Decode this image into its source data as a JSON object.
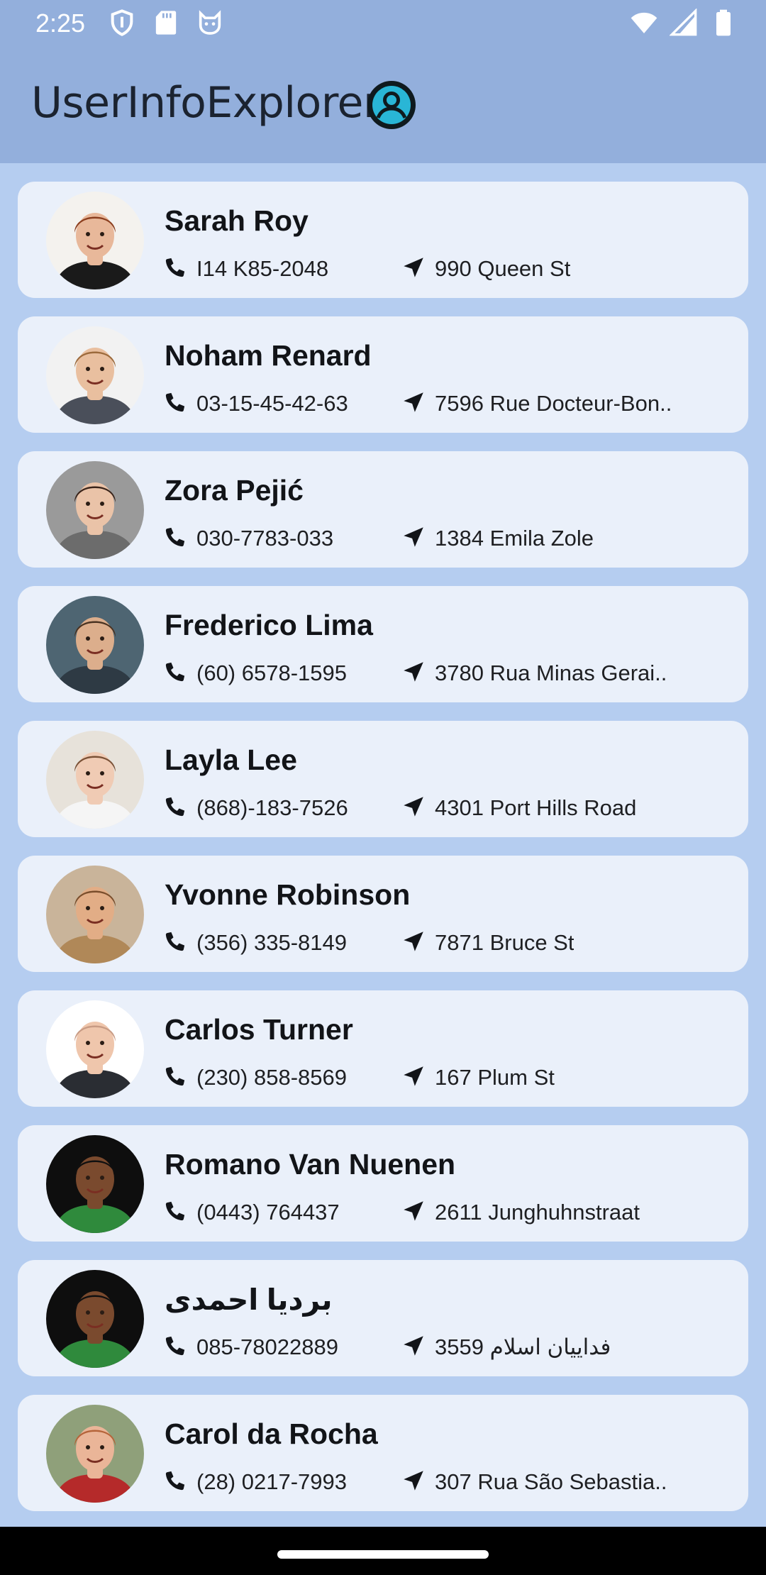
{
  "status_bar": {
    "time": "2:25",
    "left_icons": [
      "shield-icon",
      "sd-card-icon",
      "cat-face-icon"
    ],
    "right_icons": [
      "wifi-icon",
      "signal-icon",
      "battery-icon"
    ]
  },
  "app_bar": {
    "title": "UserInfoExplorer",
    "logo_icon": "user-circle-icon",
    "colors": {
      "bar": "#93afdc",
      "logo_ring": "#29b6d6"
    }
  },
  "users": [
    {
      "name": "Sarah Roy",
      "phone": "I14 K85-2048",
      "address": "990 Queen St",
      "avatar": {
        "skin": "#e8b89a",
        "hair": "#8b3e1e",
        "bg": "#f4f2ee",
        "shirt": "#1a1a1a"
      }
    },
    {
      "name": "Noham Renard",
      "phone": "03-15-45-42-63",
      "address": "7596 Rue Docteur-Bon..",
      "avatar": {
        "skin": "#e9bf9f",
        "hair": "#9c6a3c",
        "bg": "#f2f2f2",
        "shirt": "#4a4f5a"
      }
    },
    {
      "name": "Zora Pejić",
      "phone": "030-7783-033",
      "address": "1384 Emila Zole",
      "avatar": {
        "skin": "#eac3a8",
        "hair": "#3a241a",
        "bg": "#9a9a9a",
        "shirt": "#6c6c6c"
      }
    },
    {
      "name": "Frederico Lima",
      "phone": "(60) 6578-1595",
      "address": "3780 Rua Minas Gerai..",
      "avatar": {
        "skin": "#dcae8c",
        "hair": "#4a3322",
        "bg": "#4e6572",
        "shirt": "#2e3a44"
      }
    },
    {
      "name": "Layla Lee",
      "phone": "(868)-183-7526",
      "address": "4301 Port Hills Road",
      "avatar": {
        "skin": "#f0cbb4",
        "hair": "#7a5136",
        "bg": "#e7e2da",
        "shirt": "#f5f5f5"
      }
    },
    {
      "name": "Yvonne Robinson",
      "phone": "(356) 335-8149",
      "address": "7871 Bruce St",
      "avatar": {
        "skin": "#e2ad86",
        "hair": "#7a4e2c",
        "bg": "#c9b49a",
        "shirt": "#b08858"
      }
    },
    {
      "name": "Carlos Turner",
      "phone": "(230) 858-8569",
      "address": "167 Plum St",
      "avatar": {
        "skin": "#efc6ac",
        "hair": "#c89b84",
        "bg": "#ffffff",
        "shirt": "#2a2d33"
      }
    },
    {
      "name": "Romano Van Nuenen",
      "phone": "(0443) 764437",
      "address": "2611 Junghuhnstraat",
      "avatar": {
        "skin": "#7a4a2e",
        "hair": "#101010",
        "bg": "#0e0e0e",
        "shirt": "#2f8a3c"
      }
    },
    {
      "name": "بردیا احمدی",
      "phone": "085-78022889",
      "address": "3559 فداییان اسلام",
      "avatar": {
        "skin": "#7a4a2e",
        "hair": "#101010",
        "bg": "#0e0e0e",
        "shirt": "#2f8a3c"
      }
    },
    {
      "name": "Carol da Rocha",
      "phone": "(28) 0217-7993",
      "address": "307 Rua São Sebastia..",
      "avatar": {
        "skin": "#eab598",
        "hair": "#b5643a",
        "bg": "#8fa07a",
        "shirt": "#b52a2a"
      }
    }
  ],
  "icons": {
    "phone": "phone-icon",
    "address": "location-arrow-icon"
  }
}
